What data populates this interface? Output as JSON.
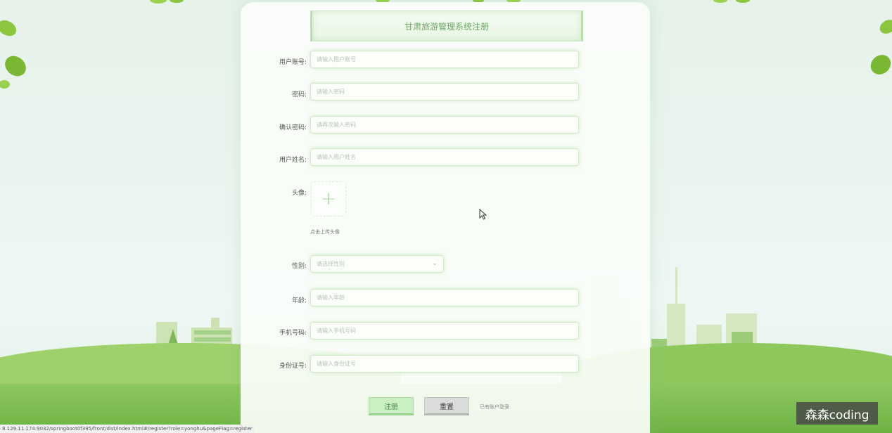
{
  "form": {
    "title": "甘肃旅游管理系统注册",
    "fields": [
      {
        "label": "用户账号:",
        "placeholder": "请输入用户账号"
      },
      {
        "label": "密码:",
        "placeholder": "请输入密码"
      },
      {
        "label": "确认密码:",
        "placeholder": "请再次输入密码"
      },
      {
        "label": "用户姓名:",
        "placeholder": "请输入用户姓名"
      }
    ],
    "avatar": {
      "label": "头像:",
      "plus": "+",
      "hint": "点击上传头像"
    },
    "gender": {
      "label": "性别:",
      "placeholder": "请选择性别",
      "chevron": "⌄"
    },
    "fields2": [
      {
        "label": "年龄:",
        "placeholder": "请输入年龄"
      },
      {
        "label": "手机号码:",
        "placeholder": "请输入手机号码"
      },
      {
        "label": "身份证号:",
        "placeholder": "请输入身份证号"
      }
    ],
    "register_label": "注册",
    "reset_label": "重置",
    "login_link": "已有账户登录"
  },
  "status_url": "8.129.11.174:9032/springboot0f395/front/dist/index.html#/register?role=yonghu&pageFlag=register",
  "watermark": "森森coding",
  "colors": {
    "accent": "#9ad08d",
    "grass": "#7cbd4f",
    "title_text": "#6aa566"
  }
}
